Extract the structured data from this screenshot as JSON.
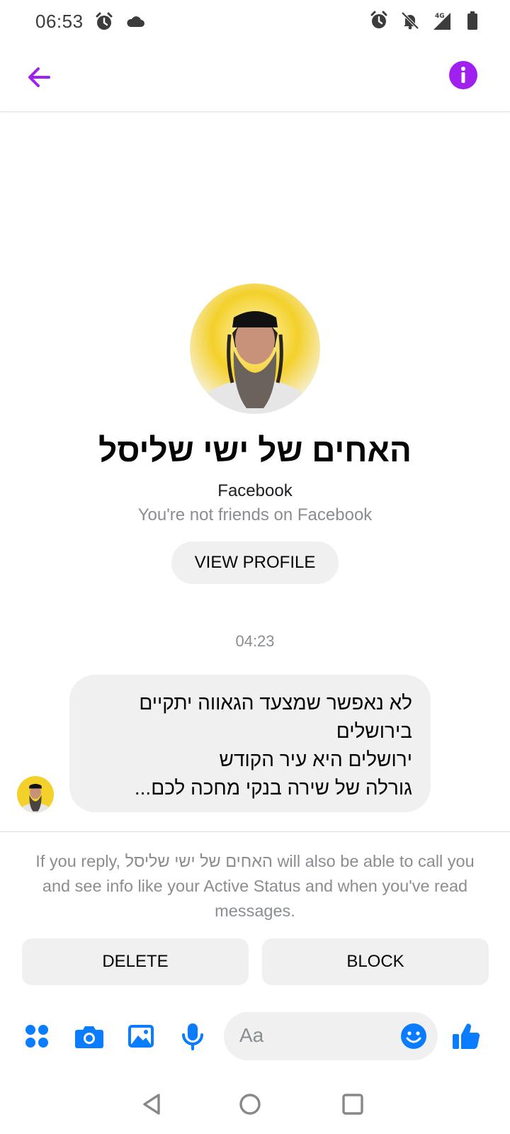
{
  "status_bar": {
    "time": "06:53",
    "left_icons": [
      "alarm-icon",
      "cloud-icon"
    ],
    "right_icons": [
      "alarm-icon",
      "bell-off-icon",
      "signal-4g-icon",
      "battery-icon"
    ],
    "network_label": "4G"
  },
  "top_bar": {
    "back_icon": "arrow-left-icon",
    "info_icon": "info-icon",
    "accent_color": "#a020f0"
  },
  "profile": {
    "name": "האחים של ישי שליסל",
    "network": "Facebook",
    "friend_status": "You're not friends on Facebook",
    "view_profile_label": "VIEW PROFILE"
  },
  "conversation": {
    "timestamp": "04:23",
    "messages": [
      {
        "direction": "incoming",
        "lines": [
          "לא נאפשר שמצעד הגאווה יתקיים",
          "בירושלים",
          "ירושלים היא עיר הקודש",
          "גורלה של שירה בנקי מחכה לכם..."
        ]
      }
    ]
  },
  "request": {
    "notice_prefix": "If you reply, ",
    "notice_name": "האחים של ישי שליסל",
    "notice_suffix": " will also be able to call you and see info like your Active Status and when you've read messages.",
    "delete_label": "DELETE",
    "block_label": "BLOCK"
  },
  "composer": {
    "icons": [
      "menu-dots-icon",
      "camera-icon",
      "gallery-icon",
      "microphone-icon",
      "emoji-icon",
      "thumbs-up-icon"
    ],
    "placeholder": "Aa",
    "icon_color": "#0a7cff"
  },
  "nav_bar": {
    "icons": [
      "back-triangle-icon",
      "home-circle-icon",
      "recents-square-icon"
    ]
  }
}
